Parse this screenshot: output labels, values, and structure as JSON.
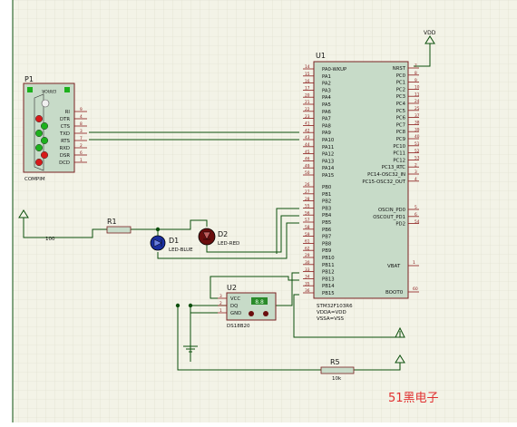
{
  "colors": {
    "sheet": "#f3f3e7",
    "grid": "#dcdccc",
    "wire": "#0b4f0b",
    "chip_fill": "#c7dbc8",
    "chip_stroke": "#7a2222",
    "pin": "#8b1a1a",
    "pin_num": "#8b1a1a",
    "text": "#111111",
    "watermark": "#e03030",
    "led_blue": "#1a2fa0",
    "led_red": "#6a0e0e",
    "lcd": "#2a8a2a"
  },
  "u1": {
    "ref": "U1",
    "pins_left": [
      "PA0-WKUP",
      "PA1",
      "PA2",
      "PA3",
      "PA4",
      "PA5",
      "PA6",
      "PA7",
      "PA8",
      "PA9",
      "PA10",
      "PA11",
      "PA12",
      "PA13",
      "PA14",
      "PA15"
    ],
    "pins_left_nums": [
      "14",
      "15",
      "16",
      "17",
      "20",
      "21",
      "22",
      "23",
      "41",
      "42",
      "43",
      "44",
      "45",
      "46",
      "49",
      "50"
    ],
    "pins_left_b": [
      "PB0",
      "PB1",
      "PB2",
      "PB3",
      "PB4",
      "PB5",
      "PB6",
      "PB7",
      "PB8",
      "PB9",
      "PB10",
      "PB11",
      "PB12",
      "PB13",
      "PB14",
      "PB15"
    ],
    "pins_left_b_nums": [
      "26",
      "27",
      "28",
      "55",
      "56",
      "57",
      "58",
      "59",
      "61",
      "62",
      "29",
      "30",
      "33",
      "34",
      "35",
      "36"
    ],
    "pins_right": [
      "NRST",
      "PC0",
      "PC1",
      "PC2",
      "PC3",
      "PC4",
      "PC5",
      "PC6",
      "PC7",
      "PC8",
      "PC9",
      "PC10",
      "PC11",
      "PC12",
      "PC13_RTC",
      "PC14-OSC32_IN",
      "PC15-OSC32_OUT"
    ],
    "pins_right_nums": [
      "7",
      "8",
      "9",
      "10",
      "11",
      "24",
      "25",
      "37",
      "38",
      "39",
      "40",
      "51",
      "52",
      "53",
      "2",
      "3",
      "4"
    ],
    "pins_right2": [
      "OSCIN_PD0",
      "OSCOUT_PD1",
      "PD2"
    ],
    "pins_right2_nums": [
      "5",
      "6",
      "54"
    ],
    "vbat": "VBAT",
    "vbat_num": "1",
    "boot": "BOOT0",
    "boot_num": "60",
    "part_lines": [
      "STM32F103R6",
      "VDDA=VDD",
      "VSSA=VSS"
    ]
  },
  "vdd_label": "VDD",
  "p1": {
    "ref": "P1",
    "error_label": "ERROR",
    "signals": [
      "RI",
      "DTR",
      "CTS",
      "TXD",
      "RTS",
      "RXD",
      "DSR",
      "DCD"
    ],
    "pin_nums": [
      "9",
      "4",
      "8",
      "3",
      "7",
      "2",
      "6",
      "1"
    ],
    "name": "COMPIM"
  },
  "r1": {
    "ref": "R1",
    "value": "100"
  },
  "r5": {
    "ref": "R5",
    "value": "10k"
  },
  "d1": {
    "ref": "D1",
    "name": "LED-BLUE"
  },
  "d2": {
    "ref": "D2",
    "name": "LED-RED"
  },
  "u2": {
    "ref": "U2",
    "pins": [
      "VCC",
      "DQ",
      "GND"
    ],
    "pin_nums": [
      "3",
      "2",
      "1"
    ],
    "lcd_text": "8.8",
    "name": "DS18B20"
  },
  "watermark": "51黑电子"
}
